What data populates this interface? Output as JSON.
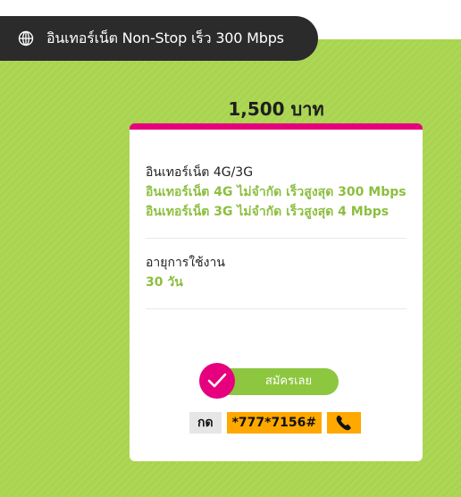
{
  "header": {
    "title": "อินเทอร์เน็ต Non-Stop เร็ว 300 Mbps",
    "icon": "globe-icon"
  },
  "package": {
    "price": "1,500 บาท",
    "internet": {
      "title": "อินเทอร์เน็ต 4G/3G",
      "line1": "อินเทอร์เน็ต 4G ไม่จำกัด เร็วสูงสุด 300 Mbps",
      "line2": "อินเทอร์เน็ต 3G ไม่จำกัด เร็วสูงสุด 4 Mbps"
    },
    "validity": {
      "title": "อายุการใช้งาน",
      "value": "30 วัน"
    }
  },
  "actions": {
    "subscribe_label": "สมัครเลย",
    "dial_prefix": "กด",
    "dial_code": "*777*7156#"
  },
  "colors": {
    "accent_pink": "#e6007e",
    "accent_green": "#8dc63f",
    "background_green": "#a9d44f",
    "dial_orange": "#ffa800",
    "header_dark": "#2b2b2b"
  }
}
